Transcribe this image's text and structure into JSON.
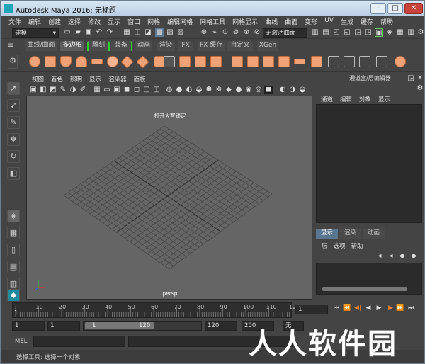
{
  "window": {
    "title": "Autodesk Maya 2016: 无标题",
    "buttons": [
      "–",
      "□",
      "✕"
    ]
  },
  "menubar": [
    "文件",
    "编辑",
    "创建",
    "选择",
    "修改",
    "显示",
    "窗口",
    "网格",
    "编辑网格",
    "网格工具",
    "网格显示",
    "曲线",
    "曲面",
    "变形",
    "UV",
    "生成",
    "缓存",
    "帮助"
  ],
  "toolbar": {
    "mode_value": "建模",
    "live_surface": "无激活曲面"
  },
  "shelf": {
    "tabs": [
      "曲线/曲面",
      "多边形",
      "雕刻",
      "装备",
      "动画",
      "渲染",
      "FX",
      "FX 缓存",
      "自定义",
      "XGen"
    ],
    "active_tab": "多边形"
  },
  "viewport_panel": {
    "menu": [
      "视图",
      "着色",
      "照明",
      "显示",
      "渲染器",
      "面板"
    ],
    "info_text": "打开大写锁定",
    "camera_label": "persp"
  },
  "right_panel": {
    "header": "通道盒/层编辑器",
    "menu": [
      "通道",
      "编辑",
      "对象",
      "显示"
    ],
    "layer_tabs": [
      "显示",
      "渲染",
      "动画"
    ],
    "active_layer_tab": "显示",
    "layer_menu": [
      "层",
      "选项",
      "帮助"
    ]
  },
  "timeline": {
    "ticks": [
      "1",
      "10",
      "20",
      "30",
      "40",
      "50",
      "60",
      "70",
      "80",
      "90",
      "100",
      "110",
      "12"
    ],
    "current_frame": "1"
  },
  "range": {
    "start": "1",
    "playback_start": "1",
    "slider_start": "1",
    "slider_end": "120",
    "playback_end": "120",
    "end": "200",
    "extra": "无"
  },
  "command_line": {
    "label": "MEL"
  },
  "help_line": {
    "text": "选择工具: 选择一个对象"
  },
  "watermark": "人人软件园"
}
